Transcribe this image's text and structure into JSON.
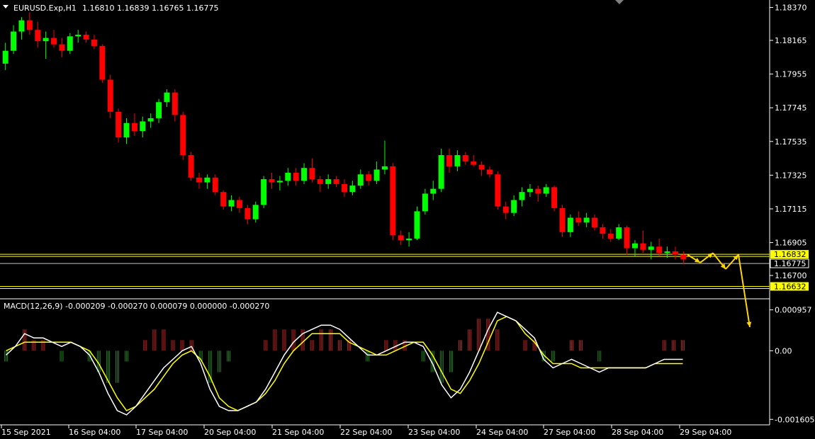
{
  "header": {
    "symbol_info": "EURUSD.Exp,H1",
    "ohlc": "1.16810 1.16839 1.16765 1.16775"
  },
  "chart_data": [
    {
      "type": "candlestick",
      "title": "EURUSD.Exp,H1",
      "price_axis_ticks": [
        "1.18370",
        "1.18165",
        "1.17955",
        "1.17745",
        "1.17535",
        "1.17325",
        "1.17115",
        "1.16905",
        "1.16700"
      ],
      "ylim": [
        1.1659,
        1.1839
      ],
      "grid": false,
      "candles": [
        [
          1.1802,
          1.1815,
          1.1798,
          1.181
        ],
        [
          1.181,
          1.1826,
          1.1808,
          1.1822
        ],
        [
          1.1822,
          1.1831,
          1.1817,
          1.1829
        ],
        [
          1.1829,
          1.1834,
          1.182,
          1.1823
        ],
        [
          1.1823,
          1.1828,
          1.1812,
          1.1816
        ],
        [
          1.1816,
          1.1822,
          1.1805,
          1.1818
        ],
        [
          1.1818,
          1.1823,
          1.1812,
          1.1814
        ],
        [
          1.1814,
          1.1818,
          1.1806,
          1.181
        ],
        [
          1.181,
          1.1821,
          1.1808,
          1.1819
        ],
        [
          1.1819,
          1.1823,
          1.1815,
          1.182
        ],
        [
          1.182,
          1.1822,
          1.1815,
          1.1817
        ],
        [
          1.1817,
          1.182,
          1.1811,
          1.1813
        ],
        [
          1.1813,
          1.1814,
          1.179,
          1.1792
        ],
        [
          1.1792,
          1.1795,
          1.1768,
          1.1772
        ],
        [
          1.1772,
          1.1774,
          1.1753,
          1.1756
        ],
        [
          1.1756,
          1.1768,
          1.1752,
          1.1765
        ],
        [
          1.1765,
          1.1771,
          1.1757,
          1.176
        ],
        [
          1.176,
          1.1769,
          1.1756,
          1.1766
        ],
        [
          1.1766,
          1.1771,
          1.1762,
          1.1768
        ],
        [
          1.1768,
          1.178,
          1.1765,
          1.1778
        ],
        [
          1.1778,
          1.1786,
          1.1775,
          1.1784
        ],
        [
          1.1784,
          1.1786,
          1.1766,
          1.177
        ],
        [
          1.177,
          1.1772,
          1.1742,
          1.1745
        ],
        [
          1.1745,
          1.1747,
          1.1729,
          1.1731
        ],
        [
          1.1731,
          1.1734,
          1.1724,
          1.1728
        ],
        [
          1.1728,
          1.1733,
          1.1724,
          1.1731
        ],
        [
          1.1731,
          1.1733,
          1.172,
          1.1722
        ],
        [
          1.1722,
          1.1723,
          1.1711,
          1.1713
        ],
        [
          1.1713,
          1.172,
          1.171,
          1.1717
        ],
        [
          1.1717,
          1.1719,
          1.1709,
          1.1712
        ],
        [
          1.1712,
          1.1714,
          1.1702,
          1.1705
        ],
        [
          1.1705,
          1.1716,
          1.1703,
          1.1714
        ],
        [
          1.1714,
          1.1732,
          1.1712,
          1.173
        ],
        [
          1.173,
          1.1734,
          1.1724,
          1.1728
        ],
        [
          1.1728,
          1.1732,
          1.1723,
          1.1729
        ],
        [
          1.1729,
          1.1737,
          1.1726,
          1.1734
        ],
        [
          1.1734,
          1.1737,
          1.1726,
          1.1729
        ],
        [
          1.1729,
          1.174,
          1.1727,
          1.1737
        ],
        [
          1.1737,
          1.1743,
          1.1728,
          1.173
        ],
        [
          1.173,
          1.1732,
          1.1722,
          1.1727
        ],
        [
          1.1727,
          1.1733,
          1.1724,
          1.173
        ],
        [
          1.173,
          1.1732,
          1.1725,
          1.1727
        ],
        [
          1.1727,
          1.173,
          1.1719,
          1.1722
        ],
        [
          1.1722,
          1.1729,
          1.172,
          1.1726
        ],
        [
          1.1726,
          1.1736,
          1.1724,
          1.1733
        ],
        [
          1.1733,
          1.1735,
          1.1726,
          1.1729
        ],
        [
          1.1729,
          1.1741,
          1.1727,
          1.1736
        ],
        [
          1.1736,
          1.1754,
          1.1733,
          1.1738
        ],
        [
          1.1738,
          1.174,
          1.1692,
          1.1695
        ],
        [
          1.1695,
          1.1698,
          1.1689,
          1.1692
        ],
        [
          1.1692,
          1.1697,
          1.1688,
          1.1693
        ],
        [
          1.1693,
          1.1713,
          1.1692,
          1.171
        ],
        [
          1.171,
          1.1724,
          1.1708,
          1.1721
        ],
        [
          1.1721,
          1.1729,
          1.1717,
          1.1724
        ],
        [
          1.1724,
          1.1749,
          1.1722,
          1.1745
        ],
        [
          1.1745,
          1.1749,
          1.1734,
          1.1738
        ],
        [
          1.1738,
          1.1748,
          1.1735,
          1.1745
        ],
        [
          1.1745,
          1.1747,
          1.1739,
          1.1741
        ],
        [
          1.1741,
          1.1745,
          1.1738,
          1.1739
        ],
        [
          1.1739,
          1.1741,
          1.1732,
          1.1736
        ],
        [
          1.1736,
          1.1738,
          1.1731,
          1.1733
        ],
        [
          1.1733,
          1.1735,
          1.1711,
          1.1713
        ],
        [
          1.1713,
          1.1716,
          1.1705,
          1.1709
        ],
        [
          1.1709,
          1.172,
          1.1707,
          1.1717
        ],
        [
          1.1717,
          1.1725,
          1.1713,
          1.1722
        ],
        [
          1.1722,
          1.1727,
          1.1719,
          1.1724
        ],
        [
          1.1724,
          1.1726,
          1.1716,
          1.1721
        ],
        [
          1.1721,
          1.1727,
          1.1719,
          1.1725
        ],
        [
          1.1725,
          1.1726,
          1.171,
          1.1712
        ],
        [
          1.1712,
          1.1714,
          1.1694,
          1.1697
        ],
        [
          1.1697,
          1.1708,
          1.1694,
          1.1706
        ],
        [
          1.1706,
          1.171,
          1.1701,
          1.1703
        ],
        [
          1.1703,
          1.1709,
          1.17,
          1.1706
        ],
        [
          1.1706,
          1.1708,
          1.1698,
          1.17
        ],
        [
          1.17,
          1.1702,
          1.1693,
          1.1696
        ],
        [
          1.1696,
          1.1699,
          1.1691,
          1.1693
        ],
        [
          1.1693,
          1.1702,
          1.1692,
          1.17
        ],
        [
          1.17,
          1.1701,
          1.1683,
          1.1687
        ],
        [
          1.1687,
          1.1692,
          1.1682,
          1.169
        ],
        [
          1.169,
          1.1698,
          1.1684,
          1.1686
        ],
        [
          1.1686,
          1.1691,
          1.168,
          1.1688
        ],
        [
          1.1688,
          1.1693,
          1.1682,
          1.1684
        ],
        [
          1.1684,
          1.1688,
          1.1681,
          1.1685
        ],
        [
          1.1685,
          1.1688,
          1.168,
          1.1683
        ],
        [
          1.1683,
          1.1685,
          1.1677,
          1.168
        ]
      ],
      "horizontal_lines": [
        {
          "price": 1.16832,
          "label": "1.16832",
          "color": "#ffff00"
        },
        {
          "price": 1.16775,
          "label": "1.16775",
          "color": "#c0c0c0"
        },
        {
          "price": 1.16632,
          "label": "1.16632",
          "color": "#ffff00"
        }
      ],
      "projection_arrow": {
        "color": "#ffd700",
        "points": [
          [
            1.1683,
            0
          ],
          [
            1.1678,
            1
          ],
          [
            1.1684,
            2
          ],
          [
            1.1674,
            3
          ],
          [
            1.1683,
            4
          ],
          [
            1.165,
            5
          ]
        ]
      }
    },
    {
      "type": "macd",
      "title": "MACD(12,26,9) -0.000209 -0.000270 0.000079 0.000000 -0.000270",
      "axis_ticks": [
        "0.000957",
        "0.00",
        "-0.001605"
      ],
      "ylim": [
        -0.0017,
        0.00105
      ],
      "macd_line_color": "#ffffff",
      "signal_line_color": "#ffff00",
      "macd": [
        -0.0001,
        0.0001,
        0.0004,
        0.0003,
        0.0003,
        0.0002,
        0.0001,
        0.0002,
        0.0001,
        -0.0001,
        -0.0005,
        -0.001,
        -0.0014,
        -0.0015,
        -0.0013,
        -0.001,
        -0.0007,
        -0.0004,
        -0.0002,
        0.0,
        0.0001,
        -0.0003,
        -0.0009,
        -0.0013,
        -0.0014,
        -0.0014,
        -0.0013,
        -0.0012,
        -0.0009,
        -0.0005,
        -0.0001,
        0.0002,
        0.0004,
        0.0005,
        0.0006,
        0.0006,
        0.0005,
        0.0003,
        0.0001,
        -0.0001,
        -0.0001,
        0.0,
        0.0001,
        0.0002,
        0.0002,
        0.0001,
        -0.0003,
        -0.0008,
        -0.0011,
        -0.0009,
        -0.0005,
        0.0,
        0.0005,
        0.0009,
        0.0008,
        0.0007,
        0.0005,
        0.0003,
        -0.0002,
        -0.0004,
        -0.0003,
        -0.0002,
        -0.0003,
        -0.0004,
        -0.0005,
        -0.0004,
        -0.0004,
        -0.0004,
        -0.0004,
        -0.0004,
        -0.0003,
        -0.0002,
        -0.0002,
        -0.0002
      ],
      "signal": [
        0.0,
        0.0001,
        0.0002,
        0.0002,
        0.0002,
        0.0002,
        0.0002,
        0.0002,
        0.0001,
        0.0,
        -0.0003,
        -0.0007,
        -0.0011,
        -0.0014,
        -0.0013,
        -0.0011,
        -0.0009,
        -0.0006,
        -0.0003,
        -0.0001,
        0.0,
        -0.0002,
        -0.0006,
        -0.0011,
        -0.0013,
        -0.0014,
        -0.0013,
        -0.0012,
        -0.001,
        -0.0007,
        -0.0003,
        0.0,
        0.0002,
        0.0004,
        0.0004,
        0.0004,
        0.0004,
        0.0002,
        0.0001,
        0.0,
        -0.0001,
        -0.0001,
        0.0,
        0.0001,
        0.0002,
        0.0002,
        -0.0001,
        -0.0005,
        -0.0009,
        -0.001,
        -0.0007,
        -0.0003,
        0.0002,
        0.0007,
        0.0008,
        0.0007,
        0.0004,
        0.0002,
        -0.0001,
        -0.0003,
        -0.0003,
        -0.0003,
        -0.0004,
        -0.0004,
        -0.0004,
        -0.0004,
        -0.0004,
        -0.0004,
        -0.0004,
        -0.0004,
        -0.0003,
        -0.0003,
        -0.0003,
        -0.0003
      ]
    }
  ],
  "time_axis": [
    "15 Sep 2021",
    "16 Sep 04:00",
    "17 Sep 04:00",
    "20 Sep 04:00",
    "21 Sep 04:00",
    "22 Sep 04:00",
    "23 Sep 04:00",
    "24 Sep 04:00",
    "27 Sep 04:00",
    "28 Sep 04:00",
    "29 Sep 04:00"
  ],
  "colors": {
    "bull": "#00ff00",
    "bear": "#ff0000",
    "background": "#000000",
    "axis": "#ffffff"
  }
}
